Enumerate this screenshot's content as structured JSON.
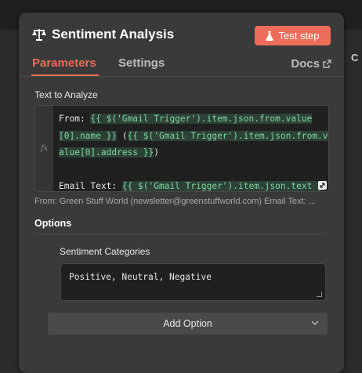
{
  "node": {
    "title": "Sentiment Analysis",
    "test_button": "Test step"
  },
  "tabs": {
    "parameters": "Parameters",
    "settings": "Settings",
    "docs": "Docs"
  },
  "text_to_analyze": {
    "label": "Text to Analyze",
    "fx_label": "fx",
    "line1_prefix": "From: ",
    "line1_expr": "{{ $('Gmail Trigger').item.json.from.value",
    "line2_expr": "[0].name }}",
    "line2_text": " (",
    "line2_expr2": "{{ $('Gmail Trigger').item.json.from.v",
    "line3_expr": "alue[0].address }}",
    "line3_text": ")",
    "line5_prefix": "Email Text: ",
    "line5_expr": "{{ $('Gmail Trigger').item.json.text }",
    "preview": "From: Green Stuff World (newsletter@greenstuffworld.com) Email Text: ..."
  },
  "options": {
    "title": "Options",
    "sentiment_label": "Sentiment Categories",
    "sentiment_value": "Positive, Neutral, Negative",
    "add_option": "Add Option"
  },
  "colors": {
    "accent": "#ec6e5a",
    "expression": "#7ed7a2"
  }
}
